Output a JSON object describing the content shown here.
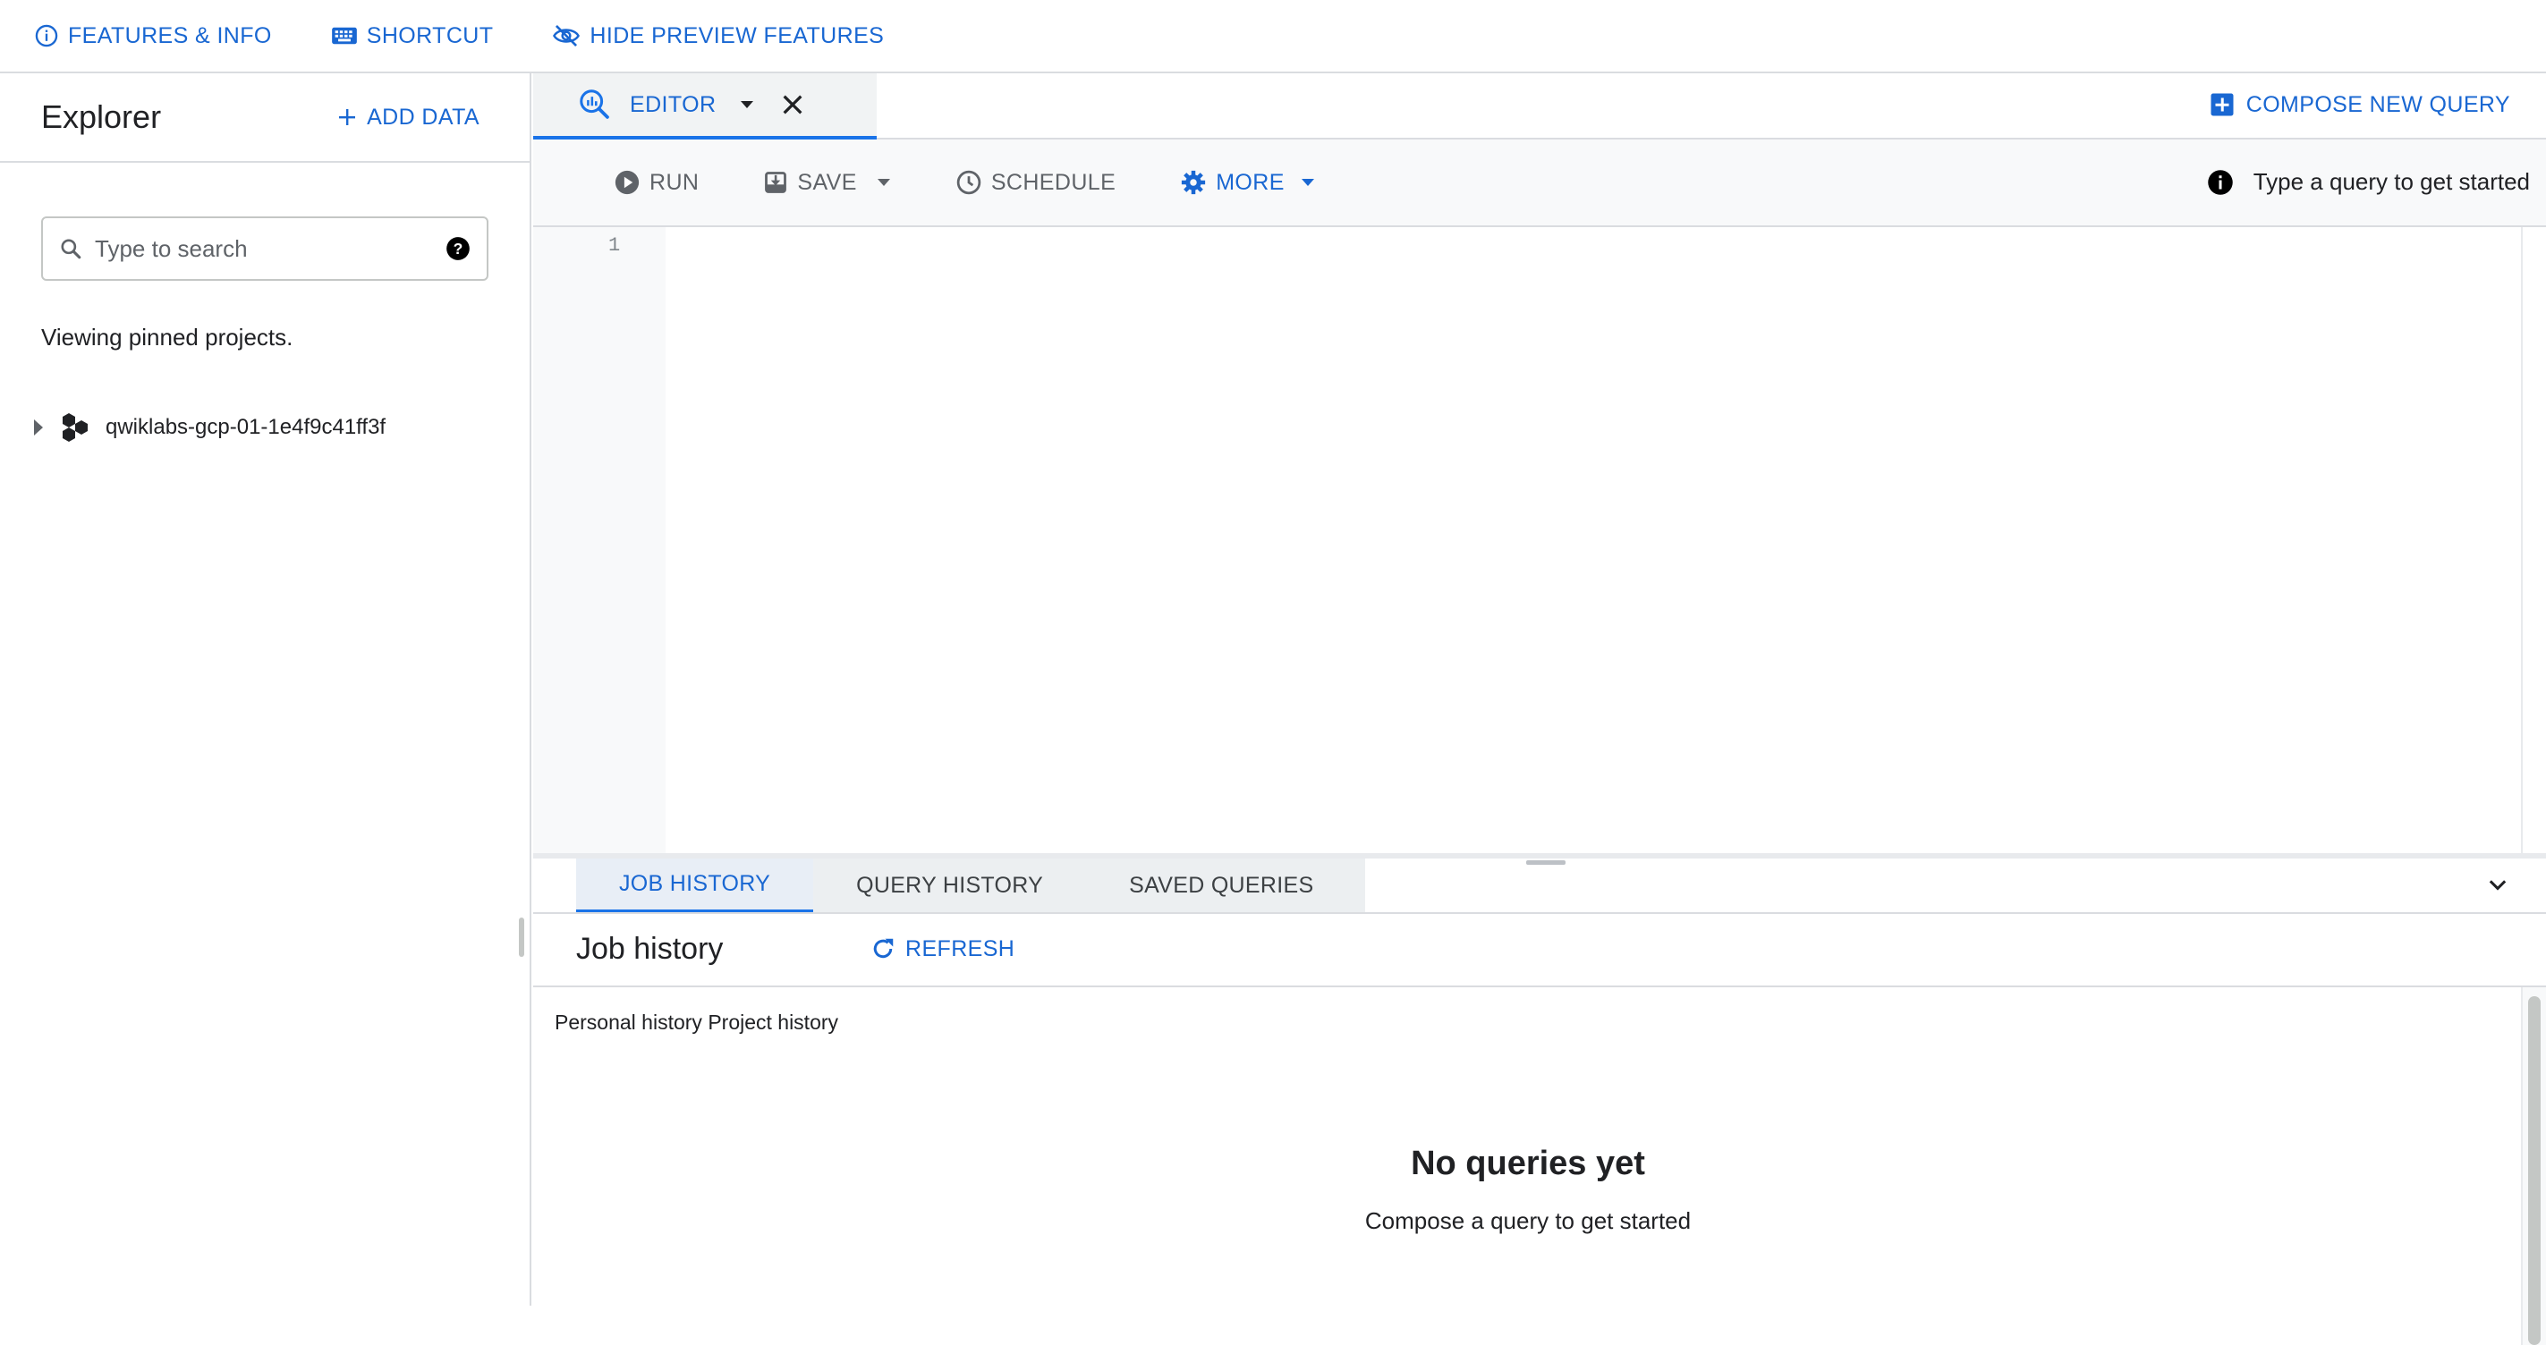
{
  "topbar": {
    "features_info": "FEATURES & INFO",
    "shortcut": "SHORTCUT",
    "hide_preview": "HIDE PREVIEW FEATURES"
  },
  "explorer": {
    "title": "Explorer",
    "add_data": "ADD DATA",
    "search_placeholder": "Type to search",
    "viewing_text": "Viewing pinned projects.",
    "project_name": "qwiklabs-gcp-01-1e4f9c41ff3f"
  },
  "tabs": {
    "editor_label": "EDITOR",
    "compose_label": "COMPOSE NEW QUERY"
  },
  "toolbar": {
    "run": "RUN",
    "save": "SAVE",
    "schedule": "SCHEDULE",
    "more": "MORE",
    "hint": "Type a query to get started"
  },
  "editor": {
    "line_numbers": [
      "1"
    ]
  },
  "bottom_panel": {
    "tabs": [
      "JOB HISTORY",
      "QUERY HISTORY",
      "SAVED QUERIES"
    ],
    "active_tab": "JOB HISTORY",
    "title": "Job history",
    "refresh": "REFRESH",
    "personal_history": "Personal history",
    "project_history": "Project history",
    "empty_title": "No queries yet",
    "empty_subtitle": "Compose a query to get started"
  },
  "colors": {
    "accent": "#1a73e8",
    "accent_text": "#1967d2",
    "border": "#dadce0",
    "toolbar_bg": "#f8f9fa"
  }
}
